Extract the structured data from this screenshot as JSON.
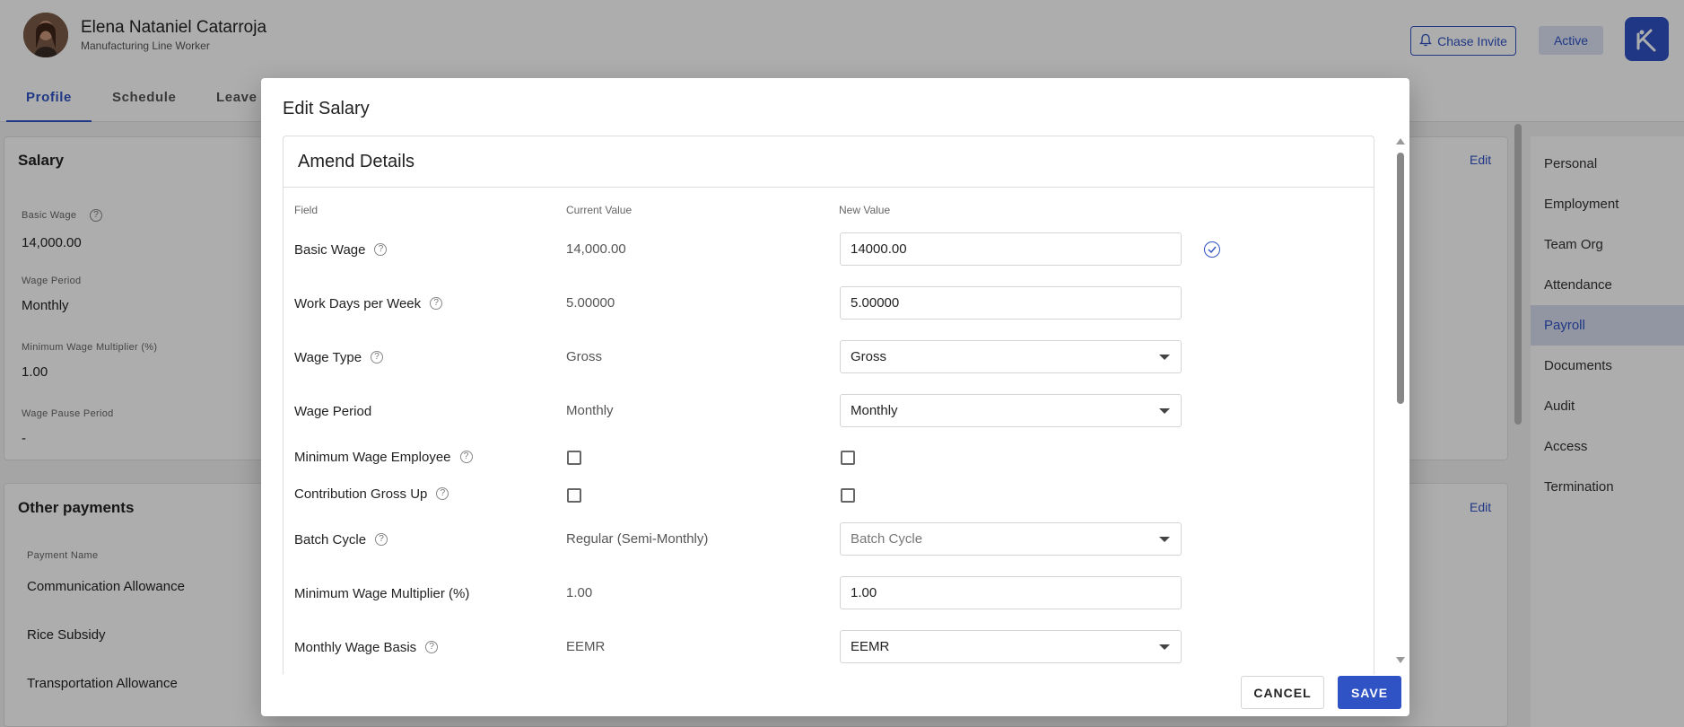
{
  "header": {
    "employee_name": "Elena Nataniel Catarroja",
    "employee_role": "Manufacturing Line Worker",
    "chase_invite_label": "Chase Invite",
    "status_badge": "Active"
  },
  "tabs": [
    {
      "label": "Profile",
      "active": true
    },
    {
      "label": "Schedule",
      "active": false
    },
    {
      "label": "Leave",
      "active": false
    }
  ],
  "salary_card": {
    "title": "Salary",
    "edit_label": "Edit",
    "fields": [
      {
        "label": "Basic Wage",
        "value": "14,000.00"
      },
      {
        "label": "Wage Period",
        "value": "Monthly"
      },
      {
        "label": "Minimum Wage Multiplier (%)",
        "value": "1.00"
      },
      {
        "label": "Wage Pause Period",
        "value": "-"
      }
    ]
  },
  "other_payments_card": {
    "title": "Other payments",
    "edit_label": "Edit",
    "column_header": "Payment Name",
    "items": [
      "Communication Allowance",
      "Rice Subsidy",
      "Transportation Allowance"
    ]
  },
  "right_nav": [
    {
      "label": "Personal",
      "active": false
    },
    {
      "label": "Employment",
      "active": false
    },
    {
      "label": "Team Org",
      "active": false
    },
    {
      "label": "Attendance",
      "active": false
    },
    {
      "label": "Payroll",
      "active": true
    },
    {
      "label": "Documents",
      "active": false
    },
    {
      "label": "Audit",
      "active": false
    },
    {
      "label": "Access",
      "active": false
    },
    {
      "label": "Termination",
      "active": false
    }
  ],
  "dialog": {
    "title": "Edit Salary",
    "section_title": "Amend Details",
    "columns": {
      "field": "Field",
      "current": "Current Value",
      "new": "New Value"
    },
    "rows": [
      {
        "label": "Basic Wage",
        "help": true,
        "current": "14,000.00",
        "new_type": "input",
        "new": "14000.00",
        "valid": true
      },
      {
        "label": "Work Days per Week",
        "help": true,
        "current": "5.00000",
        "new_type": "input",
        "new": "5.00000"
      },
      {
        "label": "Wage Type",
        "help": true,
        "current": "Gross",
        "new_type": "select",
        "new": "Gross"
      },
      {
        "label": "Wage Period",
        "help": false,
        "current": "Monthly",
        "new_type": "select",
        "new": "Monthly"
      },
      {
        "label": "Minimum Wage Employee",
        "help": true,
        "current_type": "checkbox",
        "current_checked": false,
        "new_type": "checkbox",
        "new_checked": false
      },
      {
        "label": "Contribution Gross Up",
        "help": true,
        "current_type": "checkbox",
        "current_checked": false,
        "new_type": "checkbox",
        "new_checked": false
      },
      {
        "label": "Batch Cycle",
        "help": true,
        "current": "Regular (Semi-Monthly)",
        "new_type": "select",
        "new": "",
        "placeholder": "Batch Cycle"
      },
      {
        "label": "Minimum Wage Multiplier (%)",
        "help": false,
        "current": "1.00",
        "new_type": "input",
        "new": "1.00"
      },
      {
        "label": "Monthly Wage Basis",
        "help": true,
        "current": "EEMR",
        "new_type": "select",
        "new": "EEMR"
      }
    ],
    "cancel_label": "CANCEL",
    "save_label": "SAVE"
  },
  "colors": {
    "accent": "#2f52c4",
    "overlay": "rgba(0,0,0,0.32)",
    "active_nav_bg": "#d8def0"
  }
}
